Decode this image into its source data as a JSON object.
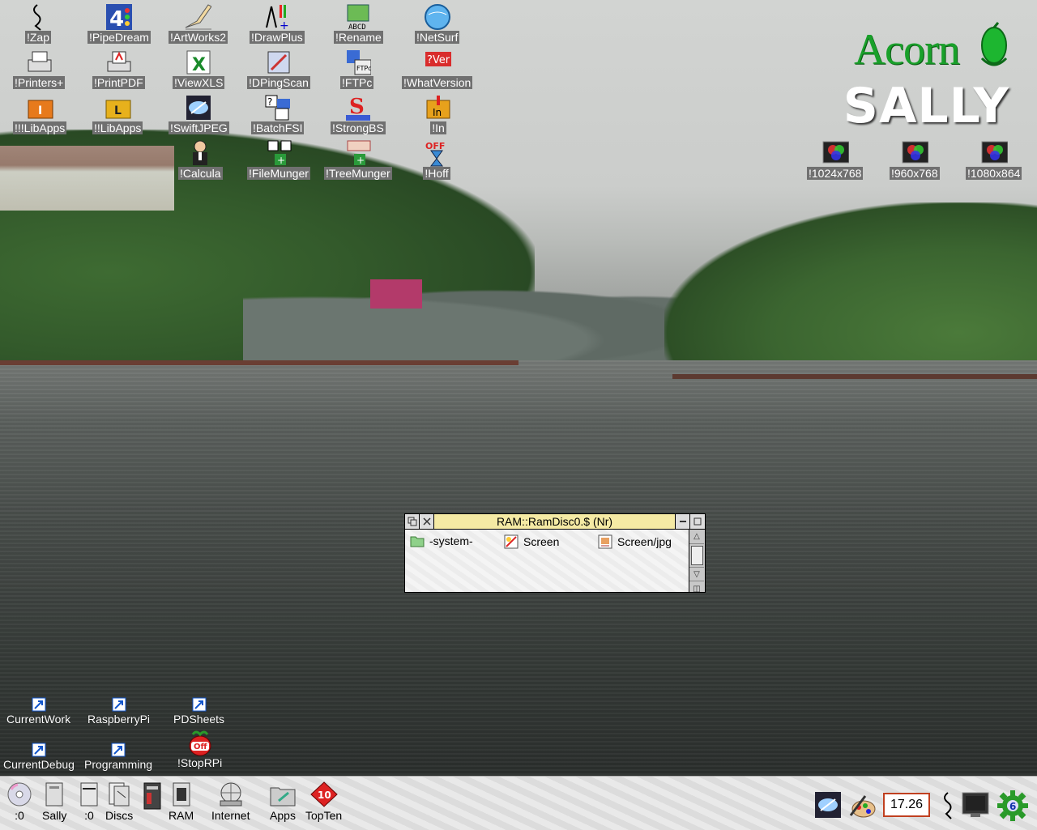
{
  "desktop": {
    "app_icons": [
      {
        "label": "!Zap",
        "icon": "zap-icon"
      },
      {
        "label": "!PipeDream",
        "icon": "pipedream-icon"
      },
      {
        "label": "!ArtWorks2",
        "icon": "artworks-icon"
      },
      {
        "label": "!DrawPlus",
        "icon": "drawplus-icon"
      },
      {
        "label": "!Rename",
        "icon": "rename-icon",
        "glyph_text": "ABCD"
      },
      {
        "label": "!NetSurf",
        "icon": "netsurf-icon"
      },
      {
        "label": "!Printers+",
        "icon": "printers-icon"
      },
      {
        "label": "!PrintPDF",
        "icon": "printpdf-icon"
      },
      {
        "label": "!ViewXLS",
        "icon": "viewxls-icon"
      },
      {
        "label": "!DPingScan",
        "icon": "dpingscan-icon"
      },
      {
        "label": "!FTPc",
        "icon": "ftpc-icon",
        "glyph_text": "FTPc"
      },
      {
        "label": "!WhatVersion",
        "icon": "whatversion-icon",
        "glyph_text": "?Ver"
      },
      {
        "label": "!!!LibApps",
        "icon": "libapps-icon",
        "glyph_text": "I"
      },
      {
        "label": "!!LibApps",
        "icon": "libapps-icon",
        "glyph_text": "L"
      },
      {
        "label": "!SwiftJPEG",
        "icon": "swiftjpeg-icon"
      },
      {
        "label": "!BatchFSI",
        "icon": "batchfsi-icon"
      },
      {
        "label": "!StrongBS",
        "icon": "strongbs-icon",
        "glyph_text": "S"
      },
      {
        "label": "!In",
        "icon": "in-icon",
        "glyph_text": "In"
      },
      {
        "label": "!Calcula",
        "icon": "calcula-icon"
      },
      {
        "label": "!FileMunger",
        "icon": "filemunger-icon"
      },
      {
        "label": "!TreeMunger",
        "icon": "treemunger-icon"
      },
      {
        "label": "!Hoff",
        "icon": "hoff-icon",
        "glyph_text": "OFF"
      }
    ],
    "screen_modes": [
      {
        "label": "!1024x768",
        "icon": "monitor-icon"
      },
      {
        "label": "!960x768",
        "icon": "monitor-icon"
      },
      {
        "label": "!1080x864",
        "icon": "monitor-icon"
      }
    ],
    "shortcuts": [
      {
        "label": "CurrentWork",
        "icon": "shortcut-arrow-icon"
      },
      {
        "label": "RaspberryPi",
        "icon": "shortcut-arrow-icon"
      },
      {
        "label": "PDSheets",
        "icon": "shortcut-arrow-icon"
      },
      {
        "label": "CurrentDebug",
        "icon": "shortcut-arrow-icon"
      },
      {
        "label": "Programming",
        "icon": "shortcut-arrow-icon"
      },
      {
        "label": "!StopRPi",
        "icon": "raspberry-off-icon",
        "glyph_text": "Off"
      }
    ],
    "branding": {
      "logo_text": "Acorn",
      "machine_name": "SALLY"
    }
  },
  "filer_window": {
    "title": "RAM::RamDisc0.$ (Nr)",
    "items": [
      {
        "name": "-system-",
        "icon": "folder-icon"
      },
      {
        "name": "Screen",
        "icon": "sprite-file-icon"
      },
      {
        "name": "Screen/jpg",
        "icon": "jpeg-file-icon"
      }
    ]
  },
  "iconbar": {
    "left": [
      {
        "label": ":0",
        "icon": "cd-drive-icon"
      },
      {
        "label": "Sally",
        "icon": "hard-disc-icon"
      },
      {
        "label": ":0",
        "icon": "floppy-drive-icon"
      },
      {
        "label": "Discs",
        "icon": "discs-icon"
      },
      {
        "label": "",
        "icon": "memory-icon"
      },
      {
        "label": "RAM",
        "icon": "ram-disc-icon"
      },
      {
        "label": "Internet",
        "icon": "internet-icon"
      },
      {
        "label": "Apps",
        "icon": "apps-folder-icon"
      },
      {
        "label": "TopTen",
        "icon": "topten-icon",
        "glyph_text": "10"
      }
    ],
    "clock": "17.26",
    "right_icons": [
      "swiftjpeg-icon",
      "paint-icon",
      "zap-icon",
      "display-icon",
      "task-manager-icon"
    ],
    "task_badge": "6"
  }
}
